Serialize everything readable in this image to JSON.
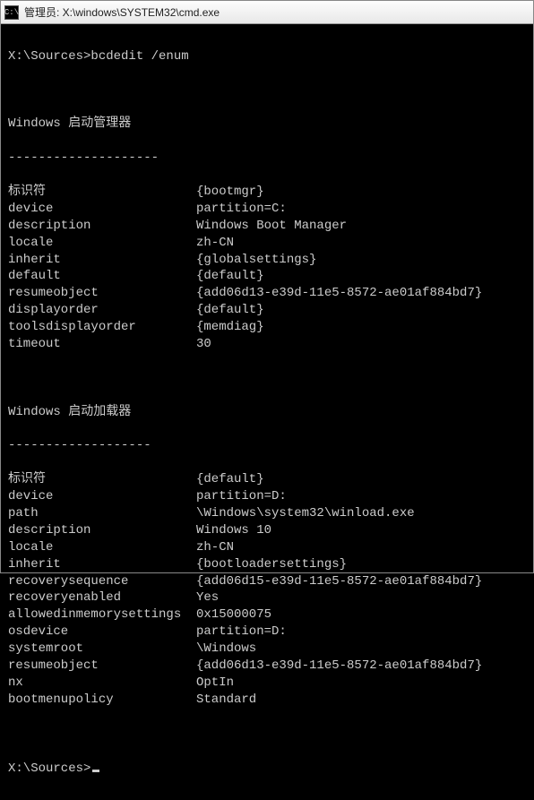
{
  "titlebar": {
    "icon_text": "C:\\",
    "title": "管理员: X:\\windows\\SYSTEM32\\cmd.exe"
  },
  "prompt1": {
    "path": "X:\\Sources>",
    "command": "bcdedit /enum"
  },
  "section1": {
    "title": "Windows 启动管理器",
    "divider": "--------------------",
    "rows": [
      {
        "k": "标识符",
        "v": "{bootmgr}"
      },
      {
        "k": "device",
        "v": "partition=C:"
      },
      {
        "k": "description",
        "v": "Windows Boot Manager"
      },
      {
        "k": "locale",
        "v": "zh-CN"
      },
      {
        "k": "inherit",
        "v": "{globalsettings}"
      },
      {
        "k": "default",
        "v": "{default}"
      },
      {
        "k": "resumeobject",
        "v": "{add06d13-e39d-11e5-8572-ae01af884bd7}"
      },
      {
        "k": "displayorder",
        "v": "{default}"
      },
      {
        "k": "toolsdisplayorder",
        "v": "{memdiag}"
      },
      {
        "k": "timeout",
        "v": "30"
      }
    ]
  },
  "section2": {
    "title": "Windows 启动加载器",
    "divider": "-------------------",
    "rows": [
      {
        "k": "标识符",
        "v": "{default}"
      },
      {
        "k": "device",
        "v": "partition=D:"
      },
      {
        "k": "path",
        "v": "\\Windows\\system32\\winload.exe"
      },
      {
        "k": "description",
        "v": "Windows 10"
      },
      {
        "k": "locale",
        "v": "zh-CN"
      },
      {
        "k": "inherit",
        "v": "{bootloadersettings}"
      },
      {
        "k": "recoverysequence",
        "v": "{add06d15-e39d-11e5-8572-ae01af884bd7}"
      },
      {
        "k": "recoveryenabled",
        "v": "Yes"
      },
      {
        "k": "allowedinmemorysettings",
        "v": "0x15000075"
      },
      {
        "k": "osdevice",
        "v": "partition=D:"
      },
      {
        "k": "systemroot",
        "v": "\\Windows"
      },
      {
        "k": "resumeobject",
        "v": "{add06d13-e39d-11e5-8572-ae01af884bd7}"
      },
      {
        "k": "nx",
        "v": "OptIn"
      },
      {
        "k": "bootmenupolicy",
        "v": "Standard"
      }
    ]
  },
  "prompt2": {
    "path": "X:\\Sources>"
  }
}
